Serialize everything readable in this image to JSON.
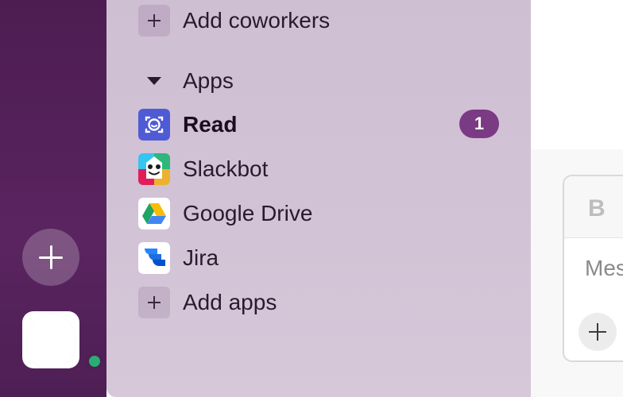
{
  "sidebar": {
    "add_coworkers_label": "Add coworkers",
    "apps_section_label": "Apps",
    "apps": [
      {
        "label": "Read",
        "icon": "read-app-icon",
        "unread": true,
        "badge": "1"
      },
      {
        "label": "Slackbot",
        "icon": "slackbot-icon"
      },
      {
        "label": "Google Drive",
        "icon": "google-drive-icon"
      },
      {
        "label": "Jira",
        "icon": "jira-icon"
      }
    ],
    "add_apps_label": "Add apps"
  },
  "composer": {
    "bold_label": "B",
    "placeholder": "Mes"
  },
  "colors": {
    "rail": "#4e1f54",
    "sidebar": "#d2c3d6",
    "badge": "#7b3a84",
    "presence": "#2bac76"
  }
}
